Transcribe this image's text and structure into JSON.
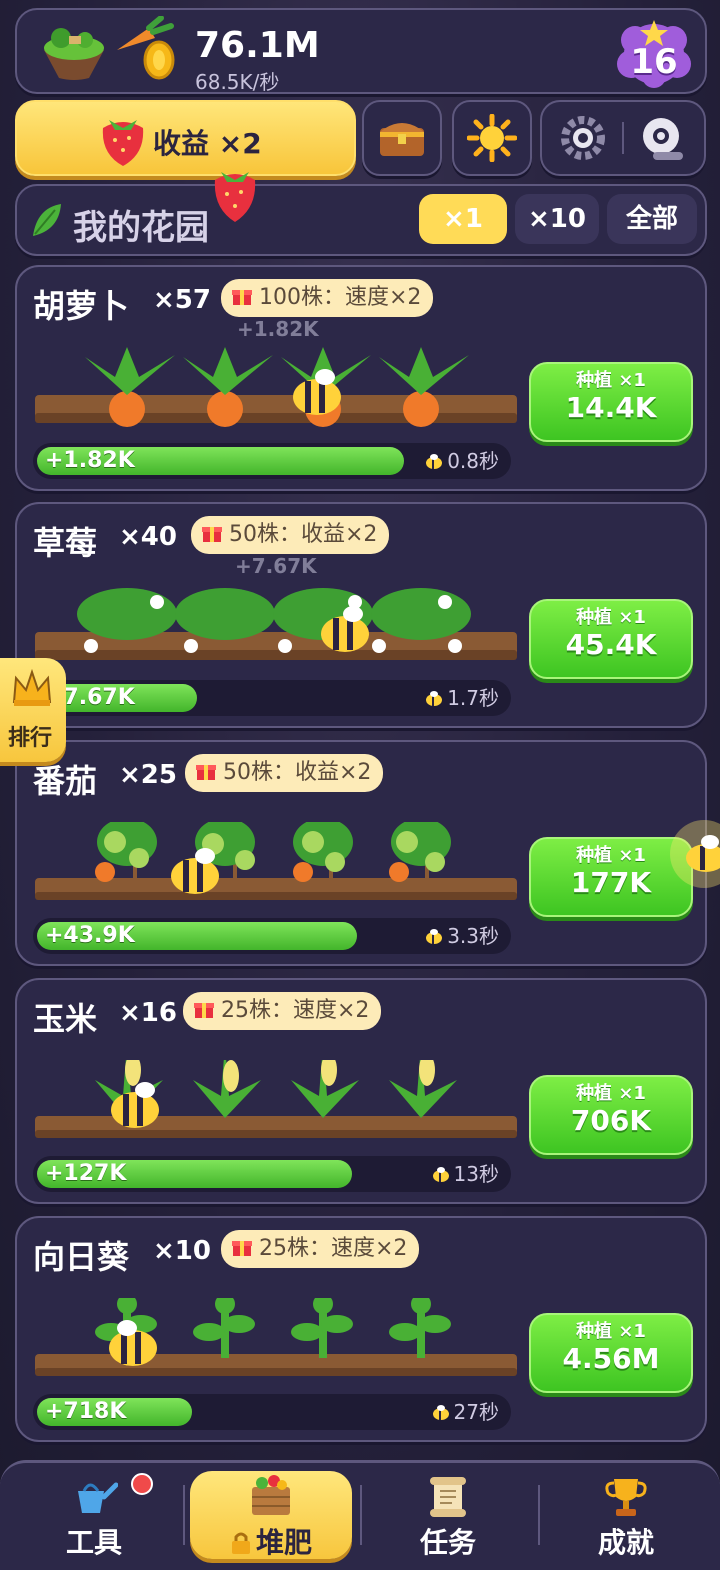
{
  "topbar": {
    "money": "76.1M",
    "rate": "68.5K/秒",
    "level": "16"
  },
  "bonus_button": {
    "label": "收益 ×2"
  },
  "garden": {
    "title": "我的花园",
    "multipliers": [
      "×1",
      "×10",
      "全部"
    ],
    "active_multiplier": "×1"
  },
  "side": {
    "rank_label": "排行"
  },
  "crops": [
    {
      "name": "胡萝卜",
      "count": "×57",
      "bonus": "100株：速度×2",
      "float": "+1.82K",
      "production": "+1.82K",
      "time": "0.8秒",
      "progress": 0.78,
      "plant_label": "种植 ×1",
      "plant_cost": "14.4K"
    },
    {
      "name": "草莓",
      "count": "×40",
      "bonus": "50株：收益×2",
      "float": "+7.67K",
      "production": "+7.67K",
      "time": "1.7秒",
      "progress": 0.34,
      "plant_label": "种植 ×1",
      "plant_cost": "45.4K"
    },
    {
      "name": "番茄",
      "count": "×25",
      "bonus": "50株：收益×2",
      "float": "",
      "production": "+43.9K",
      "time": "3.3秒",
      "progress": 0.68,
      "plant_label": "种植 ×1",
      "plant_cost": "177K"
    },
    {
      "name": "玉米",
      "count": "×16",
      "bonus": "25株：速度×2",
      "float": "",
      "production": "+127K",
      "time": "13秒",
      "progress": 0.67,
      "plant_label": "种植 ×1",
      "plant_cost": "706K"
    },
    {
      "name": "向日葵",
      "count": "×10",
      "bonus": "25株：速度×2",
      "float": "",
      "production": "+718K",
      "time": "27秒",
      "progress": 0.33,
      "plant_label": "种植 ×1",
      "plant_cost": "4.56M"
    }
  ],
  "nav": [
    {
      "label": "工具",
      "icon": "watering-can-icon",
      "badge": true
    },
    {
      "label": "堆肥",
      "icon": "compost-crate-icon",
      "active": true,
      "locked": true
    },
    {
      "label": "任务",
      "icon": "scroll-icon"
    },
    {
      "label": "成就",
      "icon": "trophy-icon"
    }
  ],
  "colors": {
    "accent_yellow": "#f8c53a",
    "green_button": "#3ec522",
    "panel": "#2c2848"
  }
}
